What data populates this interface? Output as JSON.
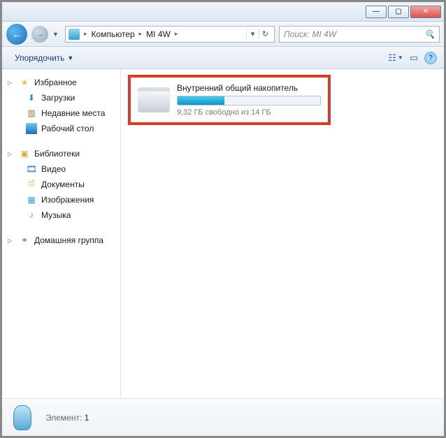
{
  "titlebar": {
    "minimize": "—",
    "maximize": "▢",
    "close": "✕"
  },
  "nav": {
    "breadcrumb": {
      "seg1": "Компьютер",
      "seg2": "MI 4W"
    },
    "search_placeholder": "Поиск: MI 4W"
  },
  "toolbar": {
    "organize": "Упорядочить"
  },
  "sidebar": {
    "favorites": {
      "head": "Избранное",
      "items": [
        "Загрузки",
        "Недавние места",
        "Рабочий стол"
      ]
    },
    "libraries": {
      "head": "Библиотеки",
      "items": [
        "Видео",
        "Документы",
        "Изображения",
        "Музыка"
      ]
    },
    "homegroup": {
      "head": "Домашняя группа"
    }
  },
  "drive": {
    "title": "Внутренний общий накопитель",
    "subtitle": "9,32 ГБ свободно из 14 ГБ",
    "used_pct": 33
  },
  "status": {
    "label": "Элемент:",
    "count": "1"
  }
}
